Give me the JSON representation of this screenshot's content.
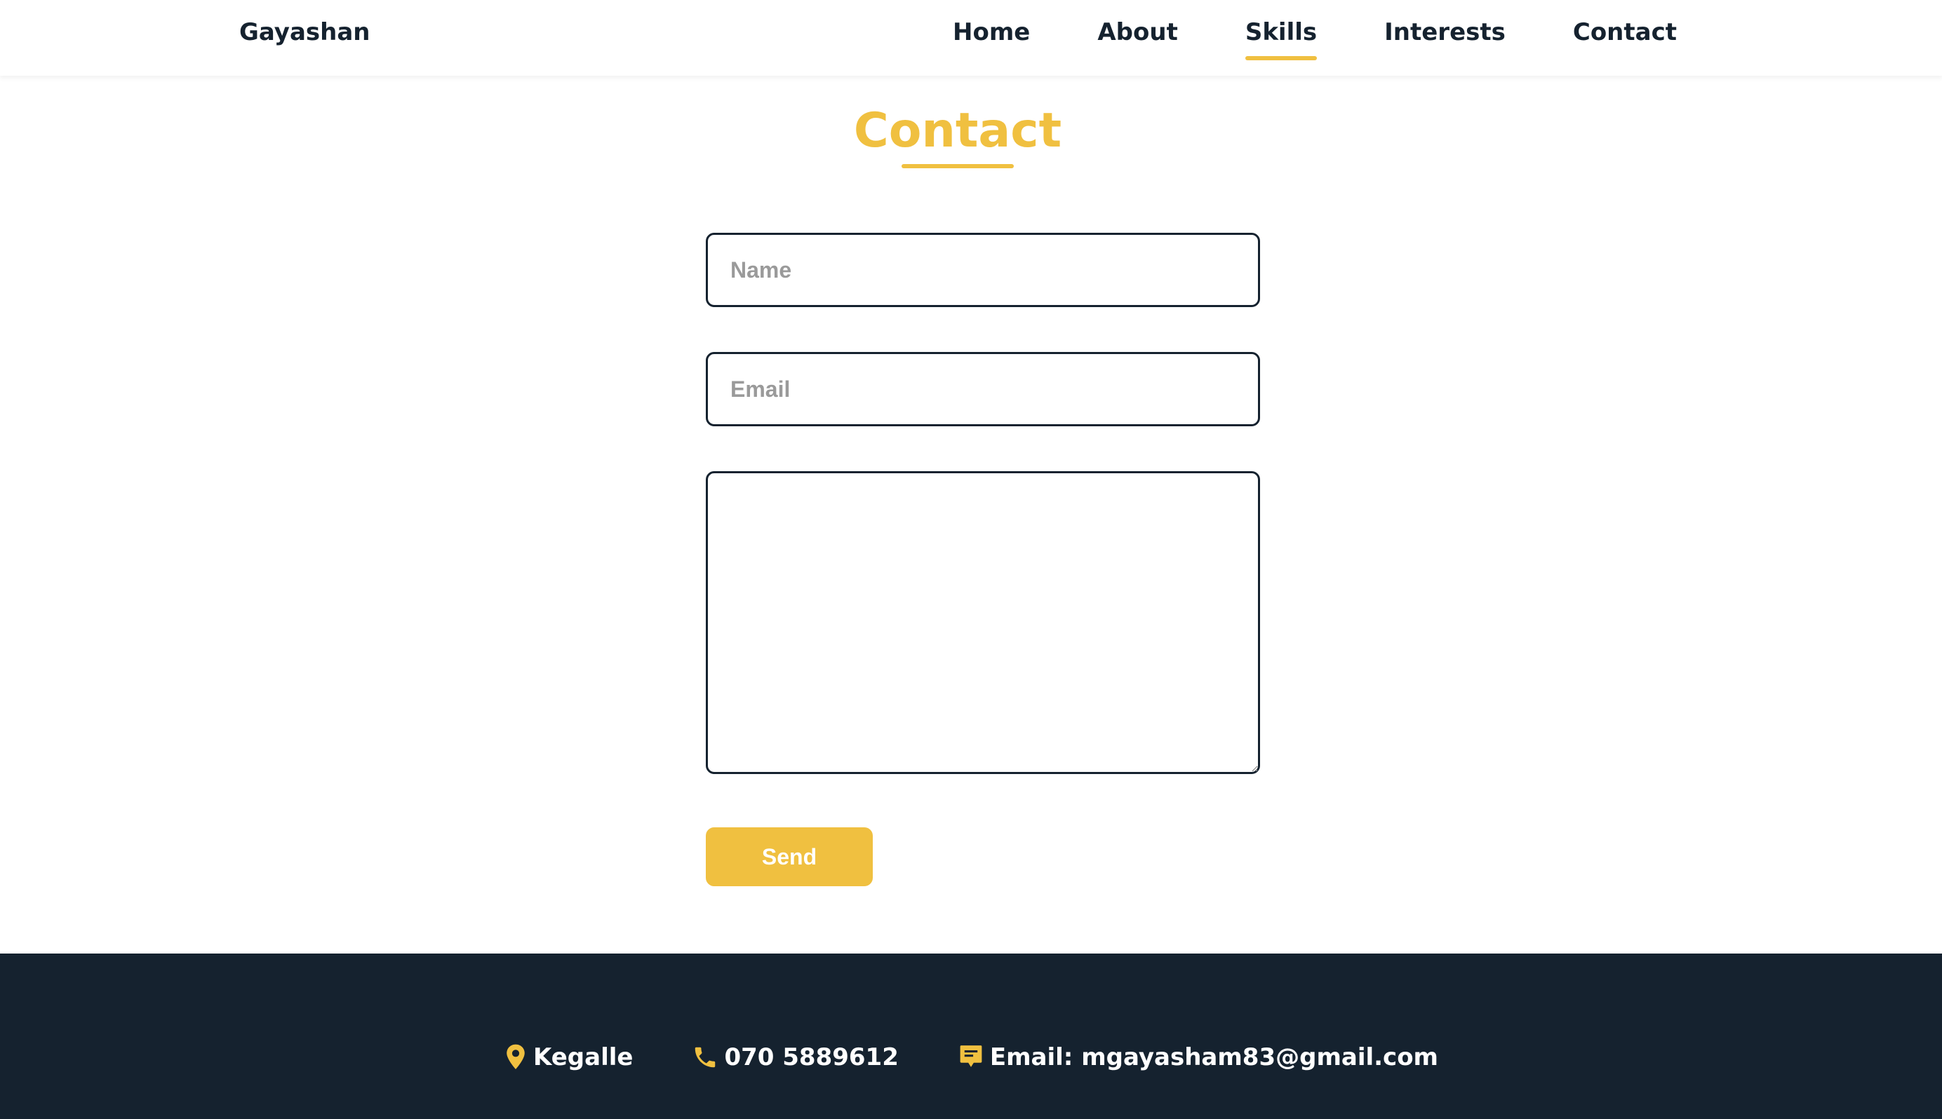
{
  "header": {
    "brand": "Gayashan",
    "nav": [
      {
        "label": "Home"
      },
      {
        "label": "About"
      },
      {
        "label": "Skills",
        "active": true
      },
      {
        "label": "Interests"
      },
      {
        "label": "Contact"
      }
    ]
  },
  "contact": {
    "title": "Contact",
    "name_placeholder": "Name",
    "email_placeholder": "Email",
    "message_value": "",
    "send_label": "Send"
  },
  "footer": {
    "location": {
      "icon": "map-pin-icon",
      "text": "Kegalle"
    },
    "phone": {
      "icon": "phone-icon",
      "text": "070 5889612"
    },
    "email": {
      "icon": "message-icon",
      "text": "Email: mgayasham83@gmail.com"
    }
  },
  "colors": {
    "accent": "#f0c040",
    "dark": "#15222f",
    "placeholder": "#9a9a9a",
    "background": "#ffffff"
  }
}
